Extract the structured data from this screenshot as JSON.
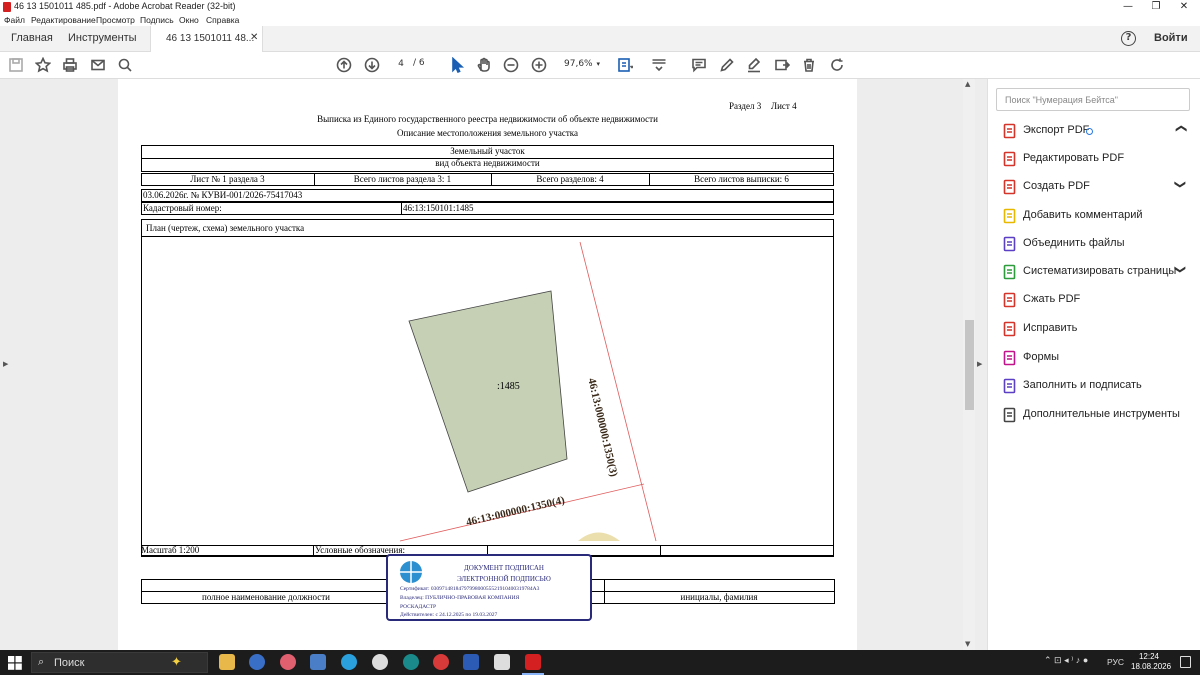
{
  "window": {
    "title": "46 13 1501011 485.pdf - Adobe Acrobat Reader (32-bit)",
    "minimize": "—",
    "restore": "❐",
    "close": "✕"
  },
  "menu": [
    "Файл",
    "Редактирование",
    "Просмотр",
    "Подпись",
    "Окно",
    "Справка"
  ],
  "tabs": {
    "home": "Главная",
    "tools": "Инструменты",
    "doc": "46 13 1501011 48...",
    "close": "✕",
    "help": "?",
    "signin": "Войти"
  },
  "toolbar": {
    "page_current": "4",
    "page_total": "/ 6",
    "zoom": "97,6%",
    "zoom_arrow": "▾"
  },
  "document": {
    "section": "Раздел 3",
    "sheet": "Лист 4",
    "title1": "Выписка из Единого государственного реестра недвижимости об объекте недвижимости",
    "title2": "Описание местоположения земельного участка",
    "obj_name": "Земельный участок",
    "obj_kind": "вид объекта недвижимости",
    "row_sheet": "Лист № 1 раздела 3",
    "row_total_sheets_section": "Всего листов раздела 3: 1",
    "row_total_sections": "Всего разделов: 4",
    "row_total_sheets_extract": "Всего листов выписки: 6",
    "date_number": "03.06.2026г. № КУВИ-001/2026-75417043",
    "cadastral_label": "Кадастровый номер:",
    "cadastral_value": "46:13:150101:1485",
    "plan_title": "План (чертеж, схема) земельного участка",
    "parcel_label": ":1485",
    "neighbor_right": "46:13:000000:1350(3)",
    "neighbor_bottom": "46:13:000000:1350(4)",
    "scale": "Масштаб 1:200",
    "legend": "Условные обозначения:",
    "position_caption": "полное наименование должности",
    "initials_caption": "инициалы, фамилия",
    "stamp": {
      "line1": "ДОКУМЕНТ ПОДПИСАН",
      "line2": "ЭЛЕКТРОННОЙ ПОДПИСЬЮ",
      "cert": "Сертификат: 0309714818479799800055521910400319784A3",
      "owner1": "Владелец: ПУБЛИЧНО-ПРАВОВАЯ КОМПАНИЯ",
      "owner2": "РОСКАДАСТР",
      "valid": "Действителен: с 24.12.2025 по 19.03.2027"
    }
  },
  "right_panel": {
    "search_placeholder": "Поиск \"Нумерация Бейтса\"",
    "items": [
      {
        "label": "Экспорт PDF",
        "icon": "export-pdf-icon",
        "color": "#d4342a",
        "chev": "❯"
      },
      {
        "label": "Редактировать PDF",
        "icon": "edit-pdf-icon",
        "color": "#d4342a",
        "chev": ""
      },
      {
        "label": "Создать PDF",
        "icon": "create-pdf-icon",
        "color": "#d4342a",
        "chev": "❯"
      },
      {
        "label": "Добавить комментарий",
        "icon": "comment-icon",
        "color": "#e8b800",
        "chev": ""
      },
      {
        "label": "Объединить файлы",
        "icon": "combine-files-icon",
        "color": "#5b3fc4",
        "chev": ""
      },
      {
        "label": "Систематизировать страницы",
        "icon": "organize-pages-icon",
        "color": "#2e9b3c",
        "chev": "❯"
      },
      {
        "label": "Сжать PDF",
        "icon": "compress-pdf-icon",
        "color": "#d4342a",
        "chev": ""
      },
      {
        "label": "Исправить",
        "icon": "redact-icon",
        "color": "#d4342a",
        "chev": ""
      },
      {
        "label": "Формы",
        "icon": "forms-icon",
        "color": "#c2148a",
        "chev": ""
      },
      {
        "label": "Заполнить и подписать",
        "icon": "fill-sign-icon",
        "color": "#5b3fc4",
        "chev": ""
      },
      {
        "label": "Дополнительные инструменты",
        "icon": "more-tools-icon",
        "color": "#444444",
        "chev": ""
      }
    ]
  },
  "taskbar": {
    "search": "Поиск",
    "lang": "РУС",
    "time": "12:24",
    "date": "18.08.2026"
  },
  "colors": {
    "parcel_fill": "#c5d0b5",
    "neighbor_line": "#e05a5a",
    "stamp_border": "#2a2a7a"
  }
}
